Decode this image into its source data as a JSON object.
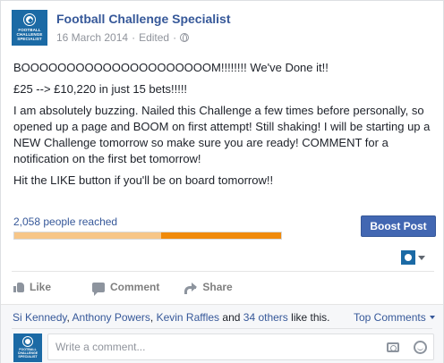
{
  "post": {
    "page_name": "Football Challenge Specialist",
    "avatar_text": "FOOTBALL CHALLENGE SPECIALIST",
    "date": "16 March 2014",
    "separator": "·",
    "edited": "Edited",
    "separator2": "·",
    "paragraphs": [
      "BOOOOOOOOOOOOOOOOOOOOOM!!!!!!!! We've Done it!!",
      "£25 --> £10,220 in just 15 bets!!!!!",
      "I am absolutely buzzing. Nailed this Challenge a few times before personally, so opened up a page and BOOM on first attempt! Still shaking! I will be starting up a NEW Challenge tomorrow so make sure you are ready! COMMENT for a notification on the first bet tomorrow!",
      "Hit the LIKE button if you'll be on board tomorrow!!"
    ]
  },
  "reach": {
    "label": "2,058 people reached",
    "organic_fraction": 0.55,
    "paid_fraction": 0.45,
    "boost_label": "Boost Post"
  },
  "actions": {
    "like": "Like",
    "comment": "Comment",
    "share": "Share"
  },
  "likes": {
    "name1": "Si Kennedy",
    "sep1": ", ",
    "name2": "Anthony Powers",
    "sep2": ", ",
    "name3": "Kevin Raffles",
    "and": " and ",
    "others": "34 others",
    "suffix": " like this.",
    "top_comments": "Top Comments"
  },
  "comment_box": {
    "placeholder": "Write a comment..."
  },
  "icons": {
    "globe": "globe-icon",
    "like": "thumbs-up-icon",
    "comment": "speech-bubble-icon",
    "share": "share-arrow-icon",
    "camera": "camera-icon",
    "smiley": "smiley-icon"
  },
  "colors": {
    "link": "#365899",
    "boost": "#4267b2",
    "bar_organic": "#f7c688",
    "bar_paid": "#f08a0b"
  }
}
